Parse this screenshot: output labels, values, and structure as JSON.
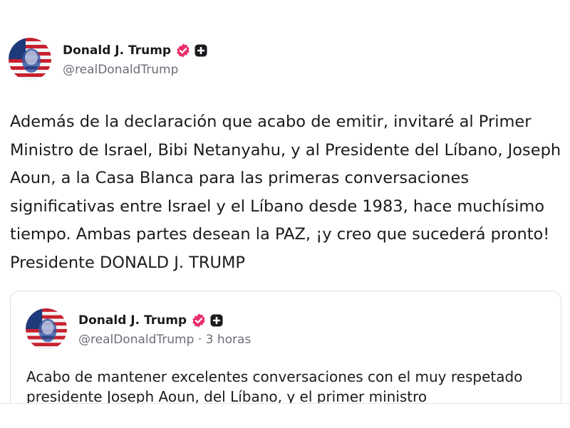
{
  "post": {
    "author": {
      "display_name": "Donald J. Trump",
      "handle": "@realDonaldTrump",
      "verified_icon": "verified-badge-icon",
      "extra_icon": "plus-badge-icon"
    },
    "body": "Además de la declaración que acabo de emitir, invitaré al Primer Ministro de Israel, Bibi Netanyahu, y al Presidente del Líbano, Joseph Aoun, a la Casa Blanca para las primeras conversaciones significativas entre Israel y el Líbano desde 1983, hace muchísimo tiempo. Ambas partes desean la PAZ, ¡y creo que sucederá pronto! Presidente DONALD J. TRUMP"
  },
  "quoted_post": {
    "author": {
      "display_name": "Donald J. Trump",
      "handle": "@realDonaldTrump",
      "separator": "·",
      "time": "3 horas"
    },
    "body": "Acabo de mantener excelentes conversaciones con el muy respetado presidente Joseph Aoun, del Líbano, y el primer ministro"
  },
  "colors": {
    "verified": "#e8306a",
    "text": "#1b1b1f",
    "muted": "#6d6e78",
    "border": "#dcdde3"
  }
}
